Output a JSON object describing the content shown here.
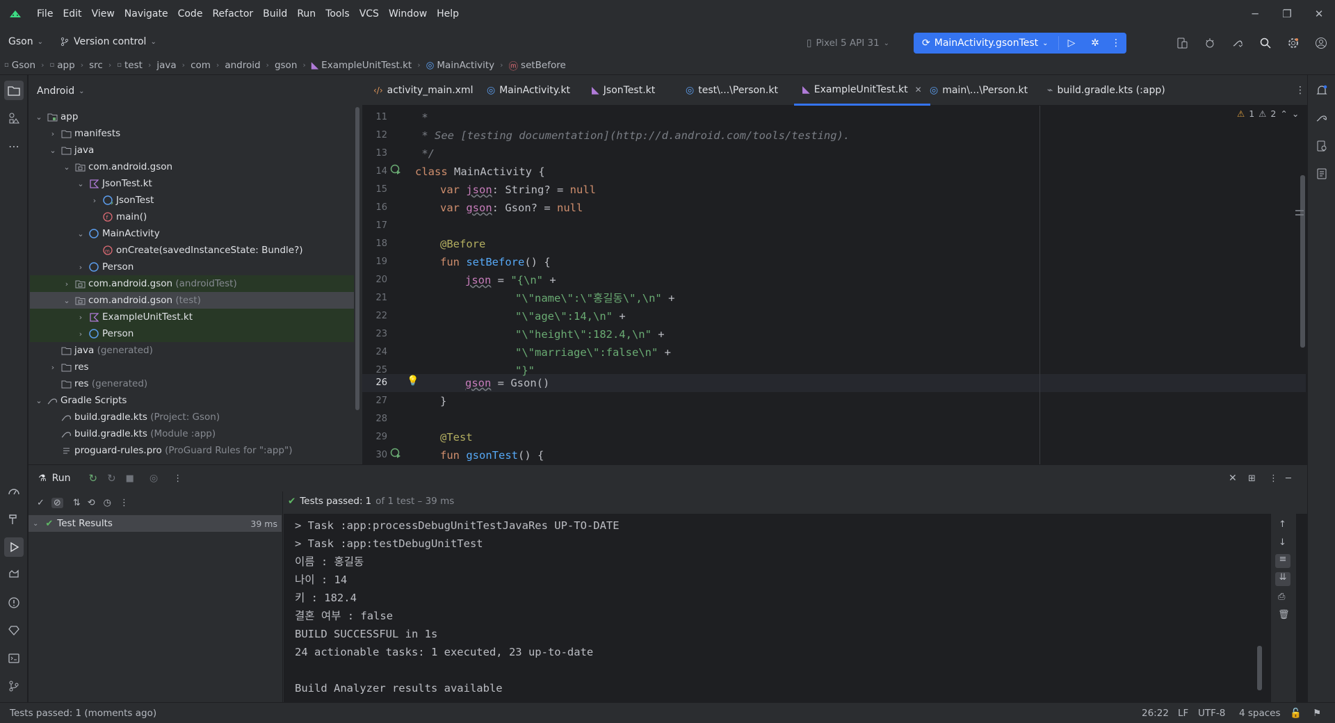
{
  "menu": [
    "File",
    "Edit",
    "View",
    "Navigate",
    "Code",
    "Refactor",
    "Build",
    "Run",
    "Tools",
    "VCS",
    "Window",
    "Help"
  ],
  "toolbar": {
    "project_name": "Gson",
    "vcs_label": "Version control",
    "device": "Pixel 5 API 31",
    "run_config": "MainActivity.gsonTest"
  },
  "breadcrumb": [
    "Gson",
    "app",
    "src",
    "test",
    "java",
    "com",
    "android",
    "gson",
    "ExampleUnitTest.kt",
    "MainActivity",
    "setBefore"
  ],
  "project": {
    "view_mode": "Android",
    "tree": [
      {
        "label": "app",
        "extra": ""
      },
      {
        "label": "manifests",
        "extra": ""
      },
      {
        "label": "java",
        "extra": ""
      },
      {
        "label": "com.android.gson",
        "extra": ""
      },
      {
        "label": "JsonTest.kt",
        "extra": ""
      },
      {
        "label": "JsonTest",
        "extra": ""
      },
      {
        "label": "main()",
        "extra": ""
      },
      {
        "label": "MainActivity",
        "extra": ""
      },
      {
        "label": "onCreate(savedInstanceState: Bundle?)",
        "extra": ""
      },
      {
        "label": "Person",
        "extra": ""
      },
      {
        "label": "com.android.gson",
        "extra": "(androidTest)"
      },
      {
        "label": "com.android.gson",
        "extra": "(test)"
      },
      {
        "label": "ExampleUnitTest.kt",
        "extra": ""
      },
      {
        "label": "Person",
        "extra": ""
      },
      {
        "label": "java",
        "extra": "(generated)"
      },
      {
        "label": "res",
        "extra": ""
      },
      {
        "label": "res",
        "extra": "(generated)"
      },
      {
        "label": "Gradle Scripts",
        "extra": ""
      },
      {
        "label": "build.gradle.kts",
        "extra": "(Project: Gson)"
      },
      {
        "label": "build.gradle.kts",
        "extra": "(Module :app)"
      },
      {
        "label": "proguard-rules.pro",
        "extra": "(ProGuard Rules for \":app\")"
      }
    ]
  },
  "tabs": [
    "activity_main.xml",
    "MainActivity.kt",
    "JsonTest.kt",
    "test\\...\\Person.kt",
    "ExampleUnitTest.kt",
    "main\\...\\Person.kt",
    "build.gradle.kts (:app)"
  ],
  "inspections": {
    "warnings": "1",
    "weak_warnings": "2"
  },
  "editor": {
    "line_numbers": [
      "11",
      "12",
      "13",
      "14",
      "15",
      "16",
      "17",
      "18",
      "19",
      "20",
      "21",
      "22",
      "23",
      "24",
      "25",
      "26",
      "27",
      "28",
      "29",
      "30"
    ],
    "lines": {
      "l11": " *",
      "l12": " * See [testing documentation](http://d.android.com/tools/testing).",
      "l13": " */",
      "l14_kw": "class",
      "l14_rest": " MainActivity {",
      "l15_kw": "var",
      "l15_prop": "json",
      "l15_rest": ": String? = ",
      "l15_null": "null",
      "l16_kw": "var",
      "l16_prop": "gson",
      "l16_rest": ": Gson? = ",
      "l16_null": "null",
      "l18": "@Before",
      "l19_kw": "fun",
      "l19_fn": "setBefore",
      "l19_rest": "() {",
      "l20_prop": "json",
      "l20_eq": " = ",
      "l20_str": "\"{\\n\"",
      "l20_plus": " +",
      "l21_str": "\"\\\"name\\\":\\\"홍길동\\\",\\n\"",
      "l21_plus": " +",
      "l22_str": "\"\\\"age\\\":14,\\n\"",
      "l22_plus": " +",
      "l23_str": "\"\\\"height\\\":182.4,\\n\"",
      "l23_plus": " +",
      "l24_str": "\"\\\"marriage\\\":false\\n\"",
      "l24_plus": " +",
      "l25_str": "\"}\"",
      "l26_prop": "gson",
      "l26_rest": " = Gson()",
      "l27": "}",
      "l29": "@Test",
      "l30_kw": "fun",
      "l30_fn": "gsonTest",
      "l30_rest": "() {"
    }
  },
  "run": {
    "title": "Run",
    "status_prefix": "Tests passed:",
    "status_count": "1",
    "status_suffix": "of 1 test – 39 ms",
    "tree_root": "Test Results",
    "tree_time": "39 ms",
    "console": [
      "> Task :app:processDebugUnitTestJavaRes UP-TO-DATE",
      "> Task :app:testDebugUnitTest",
      "이름 : 홍길동",
      "나이 : 14",
      "키 : 182.4",
      "결혼 여부 : false",
      "BUILD SUCCESSFUL in 1s",
      "24 actionable tasks: 1 executed, 23 up-to-date",
      "",
      "Build Analyzer results available"
    ]
  },
  "status": {
    "message": "Tests passed: 1 (moments ago)",
    "position": "26:22",
    "line_sep": "LF",
    "encoding": "UTF-8",
    "indent": "4 spaces"
  },
  "colors": {
    "accent": "#3574f0",
    "bg": "#1e1f22",
    "panel": "#2b2d30",
    "success": "#5fb865"
  }
}
